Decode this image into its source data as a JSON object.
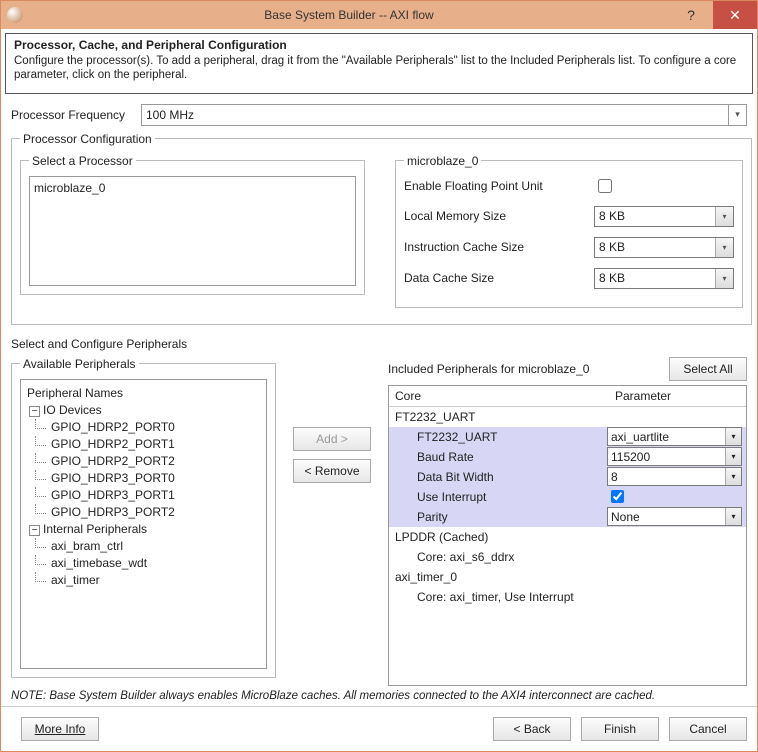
{
  "window": {
    "title": "Base System Builder -- AXI flow",
    "help": "?",
    "close": "✕"
  },
  "header": {
    "title": "Processor, Cache, and Peripheral Configuration",
    "desc": "Configure the processor(s). To add a peripheral, drag it from the \"Available Peripherals\" list to the Included Peripherals list. To configure a core parameter, click on the peripheral."
  },
  "freq": {
    "label": "Processor Frequency",
    "value": "100 MHz"
  },
  "proc_config": {
    "legend": "Processor Configuration",
    "select_label": "Select a Processor",
    "processors": [
      "microblaze_0"
    ],
    "mb0_legend": "microblaze_0",
    "fpu_label": "Enable Floating Point Unit",
    "fpu_checked": false,
    "local_mem_label": "Local Memory Size",
    "local_mem_value": "8 KB",
    "icache_label": "Instruction Cache Size",
    "icache_value": "8 KB",
    "dcache_label": "Data Cache Size",
    "dcache_value": "8 KB"
  },
  "periph": {
    "section_label": "Select and Configure Peripherals",
    "avail_legend": "Available Peripherals",
    "avail_header": "Peripheral Names",
    "tree": {
      "io": {
        "label": "IO Devices",
        "children": [
          "GPIO_HDRP2_PORT0",
          "GPIO_HDRP2_PORT1",
          "GPIO_HDRP2_PORT2",
          "GPIO_HDRP3_PORT0",
          "GPIO_HDRP3_PORT1",
          "GPIO_HDRP3_PORT2"
        ]
      },
      "internal": {
        "label": "Internal Peripherals",
        "children": [
          "axi_bram_ctrl",
          "axi_timebase_wdt",
          "axi_timer"
        ]
      }
    },
    "add_label": "Add >",
    "remove_label": "< Remove",
    "incl_label": "Included Peripherals for microblaze_0",
    "select_all": "Select All",
    "grid_head_core": "Core",
    "grid_head_param": "Parameter",
    "rows": {
      "group": "FT2232_UART",
      "r1_core": "FT2232_UART",
      "r1_param": "axi_uartlite",
      "r2_core": "Baud Rate",
      "r2_param": "115200",
      "r3_core": "Data Bit Width",
      "r3_param": "8",
      "r4_core": "Use Interrupt",
      "r4_checked": true,
      "r5_core": "Parity",
      "r5_param": "None",
      "lpddr": "LPDDR (Cached)",
      "lpddr_sub": "Core: axi_s6_ddrx",
      "timer": "axi_timer_0",
      "timer_sub": "Core: axi_timer, Use Interrupt"
    }
  },
  "note": "NOTE: Base System Builder always enables MicroBlaze caches.  All memories connected to the AXI4 interconnect are cached.",
  "footer": {
    "more_info": "More Info",
    "back": "< Back",
    "finish": "Finish",
    "cancel": "Cancel"
  }
}
